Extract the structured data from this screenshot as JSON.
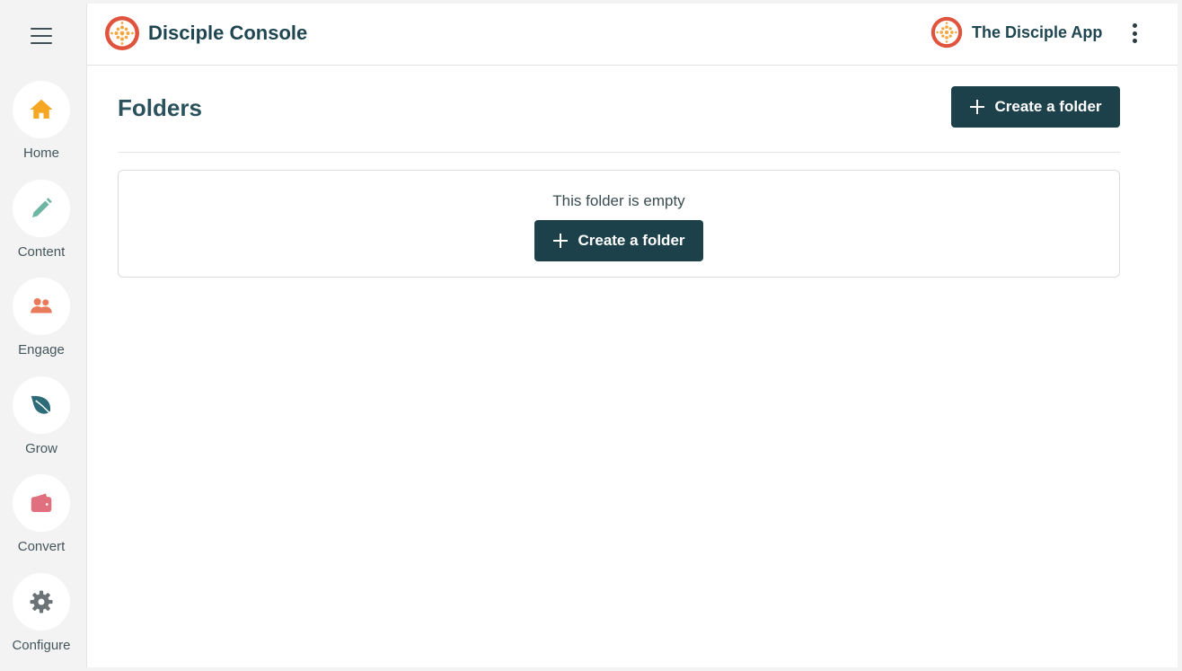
{
  "sidebar": {
    "items": [
      {
        "label": "Home",
        "icon": "home-icon",
        "color": "#f5a623"
      },
      {
        "label": "Content",
        "icon": "pencil-icon",
        "color": "#6fb5a3"
      },
      {
        "label": "Engage",
        "icon": "people-icon",
        "color": "#e97b5c"
      },
      {
        "label": "Grow",
        "icon": "leaf-icon",
        "color": "#2d6b78"
      },
      {
        "label": "Convert",
        "icon": "wallet-icon",
        "color": "#e0707e"
      },
      {
        "label": "Configure",
        "icon": "gear-icon",
        "color": "#6b7376"
      }
    ]
  },
  "header": {
    "brand_title": "Disciple Console",
    "app_name": "The Disciple App"
  },
  "main": {
    "page_title": "Folders",
    "create_button_label": "Create a folder",
    "empty_message": "This folder is empty",
    "empty_button_label": "Create a folder"
  },
  "colors": {
    "primary": "#1d414a",
    "brand_logo": "#e0533c",
    "text_dark": "#1f4650"
  }
}
